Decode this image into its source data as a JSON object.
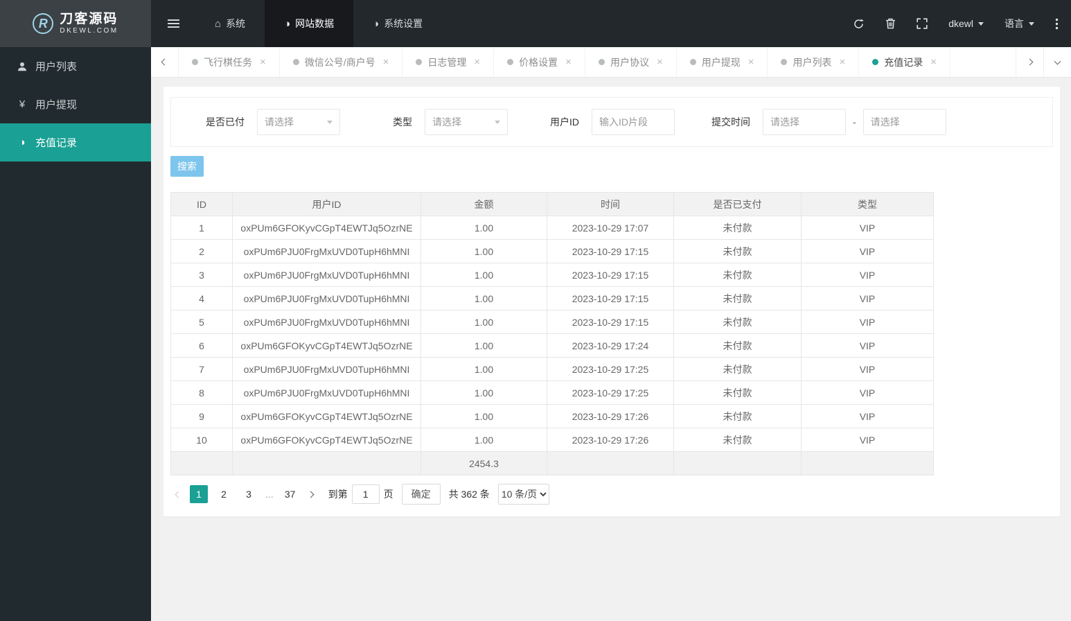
{
  "topbar": {
    "logo": {
      "title": "刀客源码",
      "subtitle": "DKEWL.COM"
    },
    "nav": {
      "system": "系统",
      "site_data": "网站数据",
      "system_settings": "系统设置"
    },
    "username": "dkewl",
    "language": "语言"
  },
  "sidebar": {
    "items": [
      {
        "label": "用户列表",
        "active": false
      },
      {
        "label": "用户提现",
        "active": false
      },
      {
        "label": "充值记录",
        "active": true
      }
    ]
  },
  "tabbar": {
    "tabs": [
      {
        "label": "飞行棋任务",
        "active": false
      },
      {
        "label": "微信公号/商户号",
        "active": false
      },
      {
        "label": "日志管理",
        "active": false
      },
      {
        "label": "价格设置",
        "active": false
      },
      {
        "label": "用户协议",
        "active": false
      },
      {
        "label": "用户提现",
        "active": false
      },
      {
        "label": "用户列表",
        "active": false
      },
      {
        "label": "充值记录",
        "active": true
      }
    ]
  },
  "filters": {
    "paid_label": "是否已付",
    "paid_placeholder": "请选择",
    "type_label": "类型",
    "type_placeholder": "请选择",
    "userid_label": "用户ID",
    "userid_placeholder": "输入ID片段",
    "time_label": "提交时间",
    "time_start_placeholder": "请选择",
    "time_end_placeholder": "请选择",
    "separator": "-",
    "search_button": "搜索"
  },
  "table": {
    "headers": [
      "ID",
      "用户ID",
      "金额",
      "时间",
      "是否已支付",
      "类型"
    ],
    "rows": [
      [
        "1",
        "oxPUm6GFOKyvCGpT4EWTJq5OzrNE",
        "1.00",
        "2023-10-29 17:07",
        "未付款",
        "VIP"
      ],
      [
        "2",
        "oxPUm6PJU0FrgMxUVD0TupH6hMNI",
        "1.00",
        "2023-10-29 17:15",
        "未付款",
        "VIP"
      ],
      [
        "3",
        "oxPUm6PJU0FrgMxUVD0TupH6hMNI",
        "1.00",
        "2023-10-29 17:15",
        "未付款",
        "VIP"
      ],
      [
        "4",
        "oxPUm6PJU0FrgMxUVD0TupH6hMNI",
        "1.00",
        "2023-10-29 17:15",
        "未付款",
        "VIP"
      ],
      [
        "5",
        "oxPUm6PJU0FrgMxUVD0TupH6hMNI",
        "1.00",
        "2023-10-29 17:15",
        "未付款",
        "VIP"
      ],
      [
        "6",
        "oxPUm6GFOKyvCGpT4EWTJq5OzrNE",
        "1.00",
        "2023-10-29 17:24",
        "未付款",
        "VIP"
      ],
      [
        "7",
        "oxPUm6PJU0FrgMxUVD0TupH6hMNI",
        "1.00",
        "2023-10-29 17:25",
        "未付款",
        "VIP"
      ],
      [
        "8",
        "oxPUm6PJU0FrgMxUVD0TupH6hMNI",
        "1.00",
        "2023-10-29 17:25",
        "未付款",
        "VIP"
      ],
      [
        "9",
        "oxPUm6GFOKyvCGpT4EWTJq5OzrNE",
        "1.00",
        "2023-10-29 17:26",
        "未付款",
        "VIP"
      ],
      [
        "10",
        "oxPUm6GFOKyvCGpT4EWTJq5OzrNE",
        "1.00",
        "2023-10-29 17:26",
        "未付款",
        "VIP"
      ]
    ],
    "summary": {
      "amount_total": "2454.3"
    }
  },
  "pagination": {
    "pages": [
      "1",
      "2",
      "3"
    ],
    "ellipsis": "...",
    "last_page": "37",
    "goto_label": "到第",
    "goto_value": "1",
    "page_unit": "页",
    "confirm_button": "确定",
    "total_text": "共 362 条",
    "page_size": "10 条/页"
  },
  "colors": {
    "accent_teal": "#1aa094",
    "search_button_blue": "#7dc5ed",
    "topbar_dark": "#23282c",
    "sidebar_dark": "#212a2e"
  },
  "icons": {
    "menu-toggle": "three-bars",
    "home": "⌂",
    "pie": "◑",
    "refresh": "circular-arrow",
    "trash": "trash-can",
    "fullscreen": "expand-corners",
    "more": "vertical-dots",
    "user": "person-silhouette",
    "yen": "¥",
    "close": "×",
    "caret-down": "▼"
  }
}
